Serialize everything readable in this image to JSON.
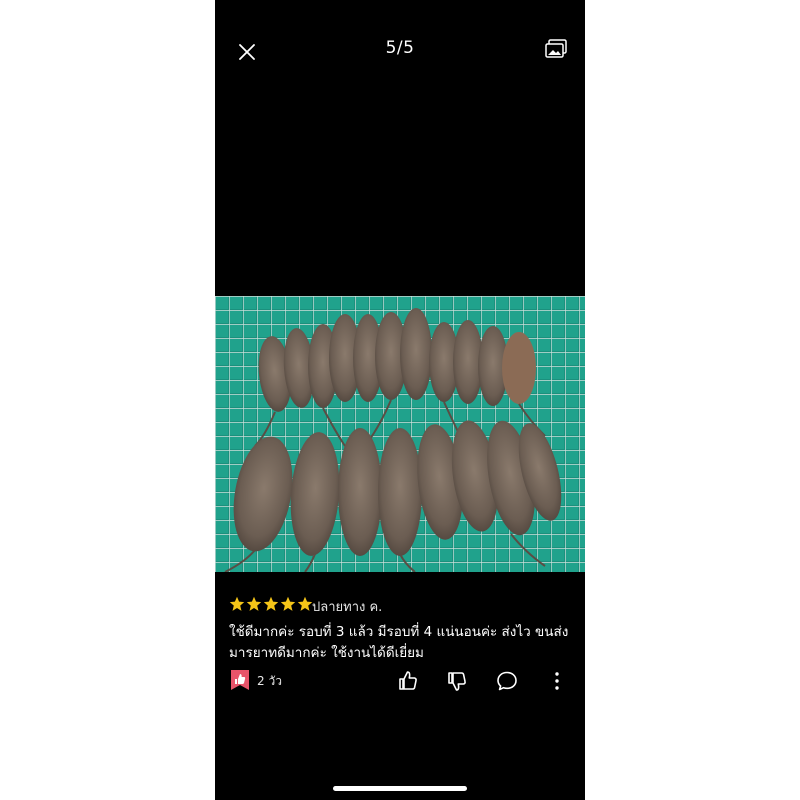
{
  "header": {
    "counter": "5/5",
    "close_icon": "close-icon",
    "gallery_icon": "gallery-icon"
  },
  "photo": {
    "description_icon": "review-photo"
  },
  "review": {
    "rating": 5,
    "reviewer": "ปลายทาง ค.",
    "comment": "ใช้ดีมากค่ะ รอบที่ 3 แล้ว มีรอบที่ 4 แน่นอนค่ะ ส่งไว ขนส่งมารยาทดีมากค่ะ ใช้งานได้ดีเยี่ยม",
    "time_ago": "2 วัว",
    "colors": {
      "star": "#f5c518",
      "badge": "#e8546a"
    }
  }
}
